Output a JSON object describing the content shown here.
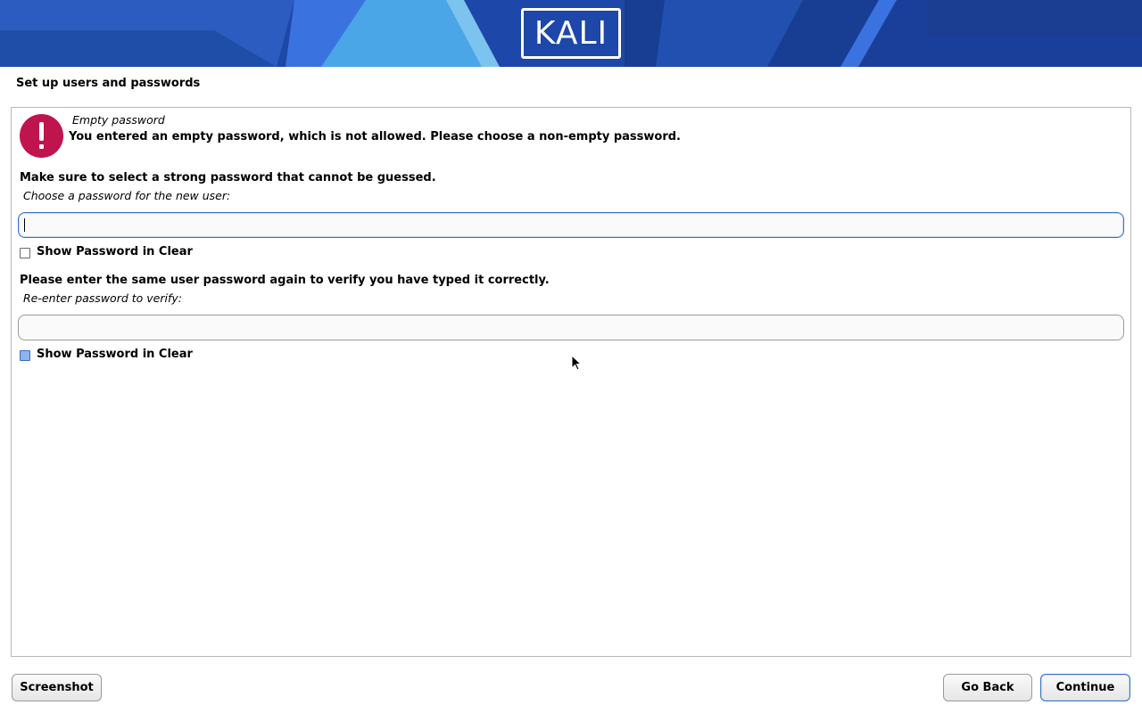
{
  "banner": {
    "logo_text": "KALI",
    "bg_color": "#1e4bb0",
    "logo_color": "#ffffff"
  },
  "page": {
    "title": "Set up users and passwords"
  },
  "alert": {
    "icon": "exclamation-icon",
    "icon_color": "#c0144f",
    "title": "Empty password",
    "message": "You entered an empty password, which is not allowed. Please choose a non-empty password."
  },
  "password": {
    "note": "Make sure to select a strong password that cannot be guessed.",
    "label": "Choose a password for the new user:",
    "value": "",
    "show_clear_label": "Show Password in Clear",
    "show_clear_checked": false
  },
  "verify": {
    "note": "Please enter the same user password again to verify you have typed it correctly.",
    "label": "Re-enter password to verify:",
    "value": "",
    "show_clear_label": "Show Password in Clear",
    "show_clear_checked": false
  },
  "buttons": {
    "screenshot": "Screenshot",
    "go_back": "Go Back",
    "continue": "Continue"
  },
  "accent_color": "#3b73c4"
}
